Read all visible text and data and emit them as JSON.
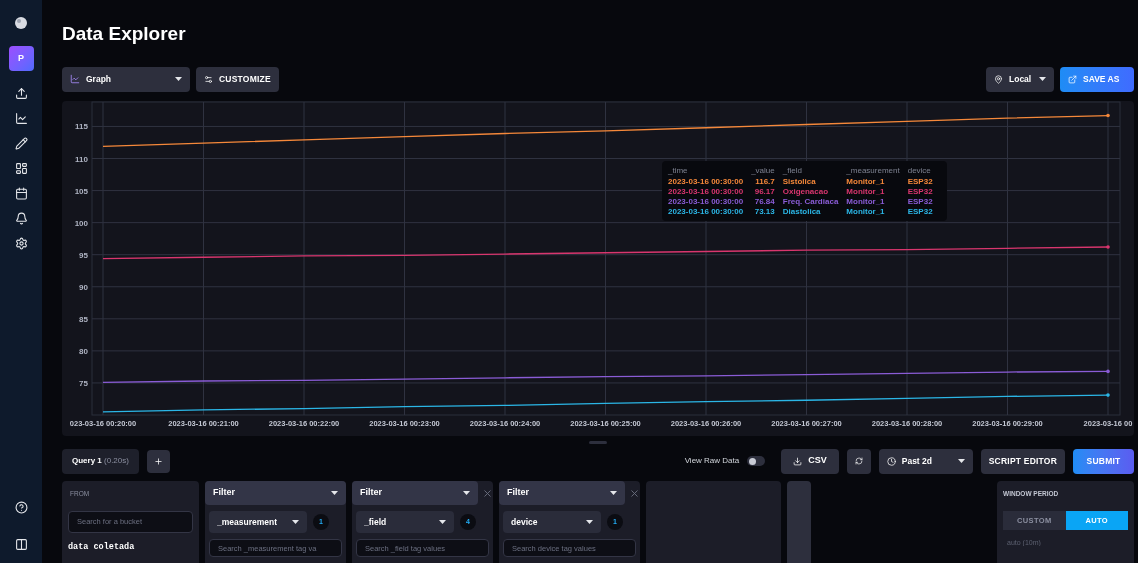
{
  "sidebar": {
    "avatar": "P"
  },
  "page_title": "Data Explorer",
  "toolbar": {
    "view_type": "Graph",
    "customize": "CUSTOMIZE",
    "timezone": "Local",
    "save_as": "SAVE AS"
  },
  "chart": {
    "chart_data": {
      "type": "line",
      "categories": [
        "023-03-16 00:20:00",
        "2023-03-16 00:21:00",
        "2023-03-16 00:22:00",
        "2023-03-16 00:23:00",
        "2023-03-16 00:24:00",
        "2023-03-16 00:25:00",
        "2023-03-16 00:26:00",
        "2023-03-16 00:27:00",
        "2023-03-16 00:28:00",
        "2023-03-16 00:29:00",
        "2023-03-16 00"
      ],
      "ylim": [
        70,
        118.5
      ],
      "grid": true,
      "yticks": [
        75,
        80,
        85,
        90,
        95,
        100,
        105,
        110,
        115
      ],
      "series": [
        {
          "name": "Sistolica",
          "color": "#f5883a",
          "values": [
            111.9,
            112.4,
            112.9,
            113.4,
            113.9,
            114.3,
            114.8,
            115.3,
            115.8,
            116.3,
            116.7
          ]
        },
        {
          "name": "Oxigenacao",
          "color": "#d9366e",
          "values": [
            94.4,
            94.6,
            94.8,
            94.9,
            95.1,
            95.3,
            95.5,
            95.7,
            95.8,
            96,
            96.2
          ]
        },
        {
          "name": "Freq. Cardiaca",
          "color": "#8a5cd6",
          "values": [
            75.1,
            75.3,
            75.4,
            75.6,
            75.8,
            76,
            76.1,
            76.3,
            76.5,
            76.7,
            76.8
          ]
        },
        {
          "name": "Diastolica",
          "color": "#2bb6e6",
          "values": [
            70.5,
            70.8,
            71,
            71.3,
            71.5,
            71.8,
            72.1,
            72.3,
            72.6,
            72.9,
            73.1
          ]
        }
      ]
    },
    "tooltip": {
      "columns": [
        "_time",
        "_value",
        "_field",
        "_measurement",
        "device"
      ],
      "rows": [
        {
          "time": "2023-03-16 00:30:00",
          "value": "116.7",
          "measurement": "Monitor_1",
          "device": "ESP32"
        },
        {
          "time": "2023-03-16 00:30:00",
          "value": "96.17",
          "measurement": "Monitor_1",
          "device": "ESP32"
        },
        {
          "time": "2023-03-16 00:30:00",
          "value": "76.84",
          "measurement": "Monitor_1",
          "device": "ESP32"
        },
        {
          "time": "2023-03-16 00:30:00",
          "value": "73.13",
          "measurement": "Monitor_1",
          "device": "ESP32"
        }
      ]
    }
  },
  "query_tabs": [
    {
      "label": "Query 1",
      "timing": "(0.20s)",
      "selected": true
    }
  ],
  "view_raw_data": {
    "label": "View Raw Data",
    "on": false
  },
  "actions": {
    "csv": "CSV",
    "time_range": "Past 2d",
    "script_editor": "SCRIPT EDITOR",
    "submit": "SUBMIT"
  },
  "from": {
    "heading": "FROM",
    "search_placeholder": "Search for a bucket",
    "bucket": "data coletada"
  },
  "filters": [
    {
      "function": "Filter",
      "key": "_measurement",
      "count": "1",
      "search_placeholder": "Search _measurement tag va",
      "removable": false
    },
    {
      "function": "Filter",
      "key": "_field",
      "count": "4",
      "search_placeholder": "Search _field tag values",
      "removable": true
    },
    {
      "function": "Filter",
      "key": "device",
      "count": "1",
      "search_placeholder": "Search device tag values",
      "removable": true
    }
  ],
  "window_period": {
    "heading": "WINDOW PERIOD",
    "options": [
      {
        "label": "CUSTOM",
        "selected": false
      },
      {
        "label": "AUTO",
        "selected": true
      }
    ],
    "placeholder": "auto (10m)"
  }
}
